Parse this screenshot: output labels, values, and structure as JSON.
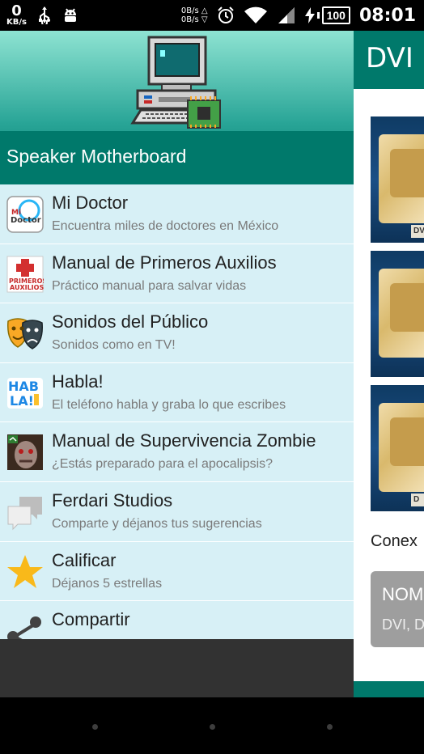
{
  "status_bar": {
    "net_rate_value": "0",
    "net_rate_unit": "KB/s",
    "speed_up": "0B/s",
    "speed_down": "0B/s",
    "battery": "100",
    "time": "08:01",
    "icons": [
      "usb-icon",
      "android-icon",
      "alarm-icon",
      "wifi-icon",
      "signal-icon",
      "charging-icon"
    ]
  },
  "background_app": {
    "title": "DVI",
    "caption": "Conex",
    "card_title": "NOM",
    "card_sub": "DVI, D",
    "photo_labels": [
      "DV",
      "",
      "D"
    ]
  },
  "drawer": {
    "app_name": "Speaker Motherboard",
    "items": [
      {
        "title": "Mi Doctor",
        "subtitle": "Encuentra miles de doctores en México",
        "icon": "mi-doctor-icon"
      },
      {
        "title": "Manual de Primeros Auxilios",
        "subtitle": "Práctico manual para salvar vidas",
        "icon": "primeros-auxilios-icon"
      },
      {
        "title": "Sonidos del Público",
        "subtitle": "Sonidos como en TV!",
        "icon": "theater-masks-icon"
      },
      {
        "title": "Habla!",
        "subtitle": "El teléfono habla y graba lo que escribes",
        "icon": "habla-icon"
      },
      {
        "title": "Manual de Supervivencia Zombie",
        "subtitle": "¿Estás preparado para el apocalipsis?",
        "icon": "zombie-icon"
      },
      {
        "title": "Ferdari Studios",
        "subtitle": "Comparte y déjanos tus sugerencias",
        "icon": "chat-bubbles-icon"
      },
      {
        "title": "Calificar",
        "subtitle": "Déjanos 5 estrellas",
        "icon": "star-icon"
      },
      {
        "title": "Compartir",
        "subtitle": "",
        "icon": "share-icon"
      }
    ]
  },
  "colors": {
    "primary": "#00796b",
    "drawer_bg": "#d7f0f6",
    "star": "#f9b91a"
  }
}
